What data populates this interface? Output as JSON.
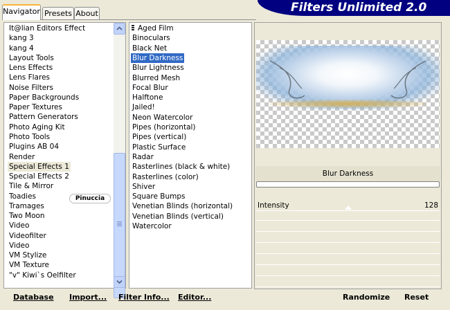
{
  "tabs": [
    "Navigator",
    "Presets",
    "About"
  ],
  "banner_title": "Filters Unlimited 2.0",
  "categories": [
    "It@lian Editors Effect",
    "kang 3",
    "kang 4",
    "Layout Tools",
    "Lens Effects",
    "Lens Flares",
    "Noise Filters",
    "Paper Backgrounds",
    "Paper Textures",
    "Pattern Generators",
    "Photo Aging Kit",
    "Photo Tools",
    "Plugins AB 04",
    "Render",
    "Special Effects 1",
    "Special Effects 2",
    "Tile & Mirror",
    "Toadies",
    "Tramages",
    "Two Moon",
    "Video",
    "Videofilter",
    "Video",
    "VM Stylize",
    "VM Texture",
    "\"v\" Kiwi`s Oelfilter"
  ],
  "highlighted_category": "Special Effects 1",
  "watermark": "Pinuccia",
  "filters": [
    "Aged Film",
    "Binoculars",
    "Black Net",
    "Blur Darkness",
    "Blur Lightness",
    "Blurred Mesh",
    "Focal Blur",
    "Halftone",
    "Jailed!",
    "Neon Watercolor",
    "Pipes (horizontal)",
    "Pipes (vertical)",
    "Plastic Surface",
    "Radar",
    "Rasterlines (black & white)",
    "Rasterlines (color)",
    "Shiver",
    "Square Bumps",
    "Venetian Blinds (horizontal)",
    "Venetian Blinds (vertical)",
    "Watercolor"
  ],
  "selected_filter": "Blur Darkness",
  "preview_caption": "Blur Darkness",
  "parameter": {
    "label": "Intensity",
    "value": "128"
  },
  "buttons": {
    "database": "Database",
    "import": "Import...",
    "filter_info": "Filter Info...",
    "editor": "Editor...",
    "randomize": "Randomize",
    "reset": "Reset"
  },
  "colors": {
    "selection": "#316ac5",
    "banner": "#000080",
    "tab_accent": "#f9b33b"
  }
}
